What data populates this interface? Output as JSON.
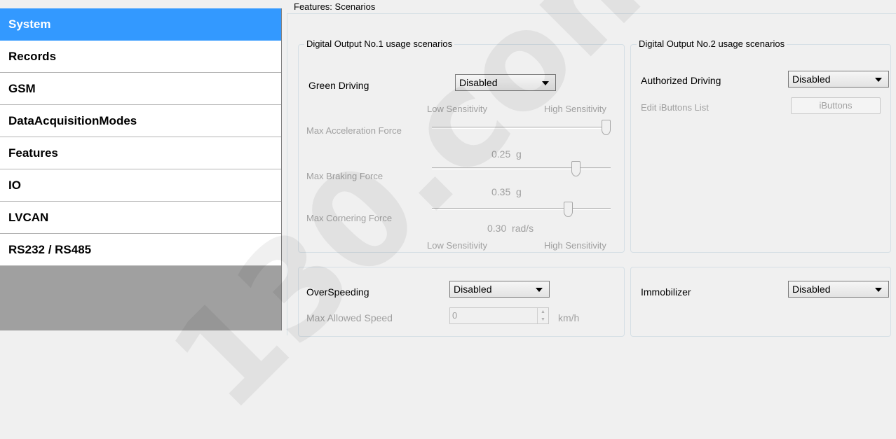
{
  "nav": {
    "items": [
      {
        "label": "System",
        "active": true
      },
      {
        "label": "Records",
        "active": false
      },
      {
        "label": "GSM",
        "active": false
      },
      {
        "label": "DataAcquisitionModes",
        "active": false
      },
      {
        "label": "Features",
        "active": false
      },
      {
        "label": "IO",
        "active": false
      },
      {
        "label": "LVCAN",
        "active": false
      },
      {
        "label": "RS232 / RS485",
        "active": false
      }
    ]
  },
  "features": {
    "title": "Features: Scenarios",
    "do1": {
      "legend": "Digital Output No.1 usage scenarios",
      "green_driving_label": "Green Driving",
      "green_driving_value": "Disabled",
      "low_sensitivity": "Low Sensitivity",
      "high_sensitivity": "High Sensitivity",
      "sliders": [
        {
          "label": "Max Acceleration Force",
          "value": "0.25",
          "unit": "g",
          "position": 1.0
        },
        {
          "label": "Max Braking Force",
          "value": "0.35",
          "unit": "g",
          "position": 0.8
        },
        {
          "label": "Max Cornering Force",
          "value": "0.30",
          "unit": "rad/s",
          "position": 0.76
        }
      ]
    },
    "do2": {
      "legend": "Digital Output No.2 usage scenarios",
      "authorized_driving_label": "Authorized Driving",
      "authorized_driving_value": "Disabled",
      "ibuttons_list_label": "Edit iButtons List",
      "ibuttons_button": "iButtons"
    },
    "overspeeding": {
      "label": "OverSpeeding",
      "value": "Disabled",
      "max_speed_label": "Max Allowed Speed",
      "max_speed_value": "0",
      "max_speed_unit": "km/h"
    },
    "immobilizer": {
      "label": "Immobilizer",
      "value": "Disabled"
    }
  },
  "watermark": "130.com"
}
